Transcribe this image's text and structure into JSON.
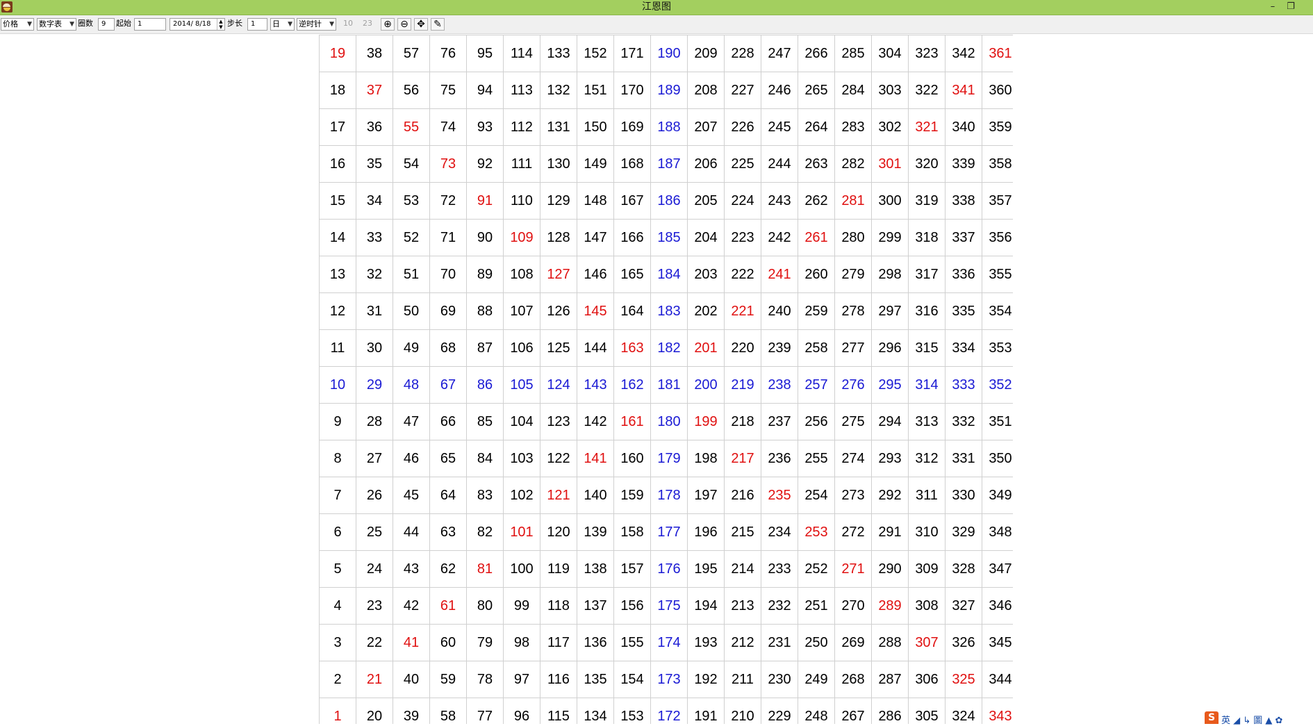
{
  "window": {
    "title": "江恩图",
    "minimize_glyph": "–",
    "restore_glyph": "❐"
  },
  "toolbar": {
    "price_select": "价格",
    "mode_select": "数字表",
    "circles_label": "圈数",
    "circles_value": "9",
    "start_label": "起始",
    "start_value": "1",
    "date_value": "2014/ 8/18",
    "step_label": "步长",
    "step_value": "1",
    "unit_select": "日",
    "direction_select": "逆时针",
    "num_a": "10",
    "num_b": "23",
    "zoom_in_glyph": "⊕",
    "zoom_out_glyph": "⊖",
    "move_glyph": "✥",
    "draw_glyph": "✎"
  },
  "grid": {
    "rows": 19,
    "columns": 19,
    "first_value_bottom_left": 1,
    "direction": "values increase upward within each column",
    "red_cells": [
      19,
      37,
      55,
      73,
      91,
      109,
      127,
      145,
      163,
      201,
      199,
      161,
      141,
      217,
      121,
      235,
      101,
      253,
      81,
      271,
      61,
      289,
      41,
      307,
      21,
      325,
      1,
      343,
      361,
      341,
      321,
      301,
      281,
      261,
      241,
      221
    ],
    "blue_cells": [
      190,
      189,
      188,
      187,
      186,
      185,
      184,
      183,
      182,
      181,
      180,
      179,
      178,
      177,
      176,
      175,
      174,
      173,
      172,
      10,
      29,
      48,
      67,
      86,
      105,
      124,
      143,
      162,
      200,
      219,
      238,
      257,
      276,
      295,
      314,
      333,
      352
    ],
    "colors": {
      "normal": "#000000",
      "red": "#e01010",
      "blue": "#1a1ad4"
    }
  },
  "tray": {
    "logo": "S",
    "text": "英 ◢ ↳ 圖 ▲ ✿"
  },
  "colors": {
    "titlebar": "#a3cf5f",
    "toolbar": "#f0f0f0",
    "grid_line": "#d0d0d0"
  }
}
